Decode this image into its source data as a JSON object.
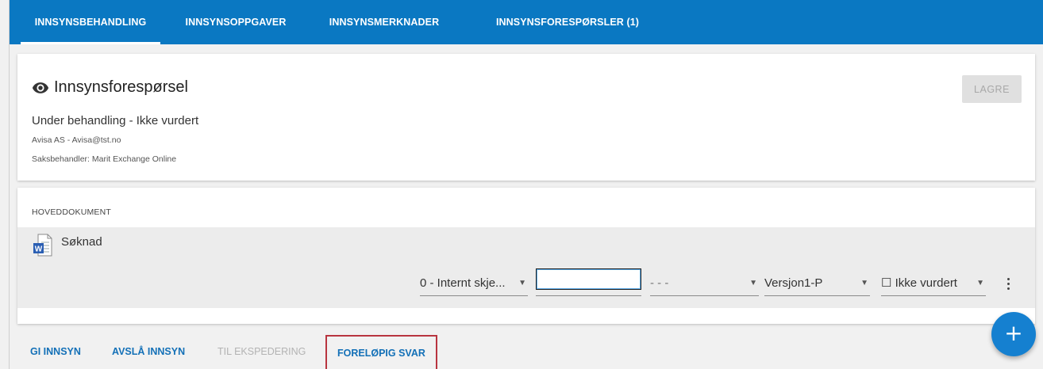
{
  "tabs": [
    {
      "label": "INNSYNSBEHANDLING",
      "active": true
    },
    {
      "label": "INNSYNSOPPGAVER",
      "active": false
    },
    {
      "label": "INNSYNSMERKNADER",
      "active": false
    },
    {
      "label": "INNSYNSFORESPØRSLER (1)",
      "active": false
    }
  ],
  "request": {
    "title": "Innsynsforespørsel",
    "status": "Under behandling - Ikke vurdert",
    "requester": "Avisa AS - Avisa@tst.no",
    "caseworker": "Saksbehandler: Marit Exchange Online",
    "save_label": "LAGRE"
  },
  "document": {
    "section_label": "HOVEDDOKUMENT",
    "name": "Søknad",
    "icon": "word-document-icon",
    "screening_select": "0 - Internt skje...",
    "text_value": "",
    "paragraph_select": "- - -",
    "version_select": "Versjon1-P",
    "assessment_select": "☐ Ikke vurdert"
  },
  "actions": {
    "grant": "GI INNSYN",
    "deny": "AVSLÅ INNSYN",
    "dispatch": "TIL EKSPEDERING",
    "preliminary": "FORELØPIG SVAR"
  },
  "fab_label": "+",
  "colors": {
    "tabbar": "#0a78c2",
    "action_link": "#1370b7",
    "highlight_border": "#b8343f",
    "fab": "#1580d0"
  }
}
